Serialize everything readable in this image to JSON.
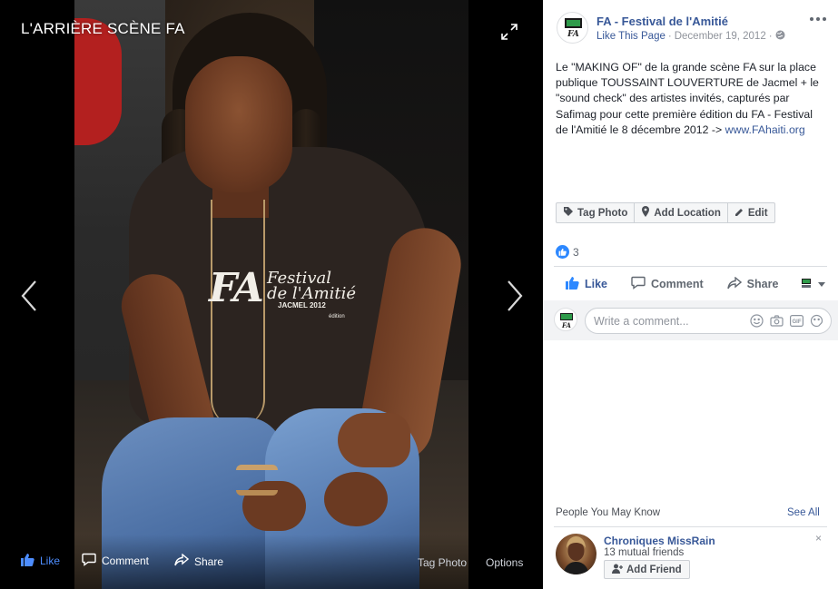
{
  "viewer": {
    "title": "L'ARRIÈRE SCÈNE FA",
    "shirt_logo": {
      "fa": "FA",
      "festival": "Festival",
      "amitie": "de l'Amitié",
      "city": "JACMEL 2012",
      "edition": "édition"
    },
    "bottom_bar": {
      "like_label": "Like",
      "comment_label": "Comment",
      "share_label": "Share",
      "tag_label": "Tag Photo",
      "options_label": "Options"
    },
    "icons": {
      "expand": "expand-icon",
      "prev": "chevron-left-icon",
      "next": "chevron-right-icon"
    }
  },
  "post": {
    "page_name": "FA - Festival de l'Amitié",
    "like_page_label": "Like This Page",
    "separator": "·",
    "date": "December 19, 2012",
    "audience_icon": "globe-icon",
    "text_main": "Le \"MAKING OF\" de la grande scène FA sur la place publique TOUSSAINT LOUVERTURE de Jacmel + le \"sound check\" des artistes invités, capturés par Safimag pour cette première édition du FA - Festival de l'Amitié le 8 décembre 2012 -> ",
    "link": "www.FAhaiti.org",
    "photo_actions": {
      "tag_photo": "Tag Photo",
      "add_location": "Add Location",
      "edit": "Edit"
    },
    "reaction_count": "3",
    "ufi": {
      "like": "Like",
      "comment": "Comment",
      "share": "Share"
    },
    "comment_placeholder": "Write a comment..."
  },
  "pymk": {
    "heading": "People You May Know",
    "see_all": "See All",
    "person": {
      "name": "Chroniques MissRain",
      "mutual": "13 mutual friends",
      "add_label": "Add Friend"
    },
    "close": "×"
  },
  "colors": {
    "link_blue": "#385898",
    "like_blue": "#2d88ff",
    "viewer_like_blue": "#4d8dff",
    "muted": "#90949c"
  }
}
